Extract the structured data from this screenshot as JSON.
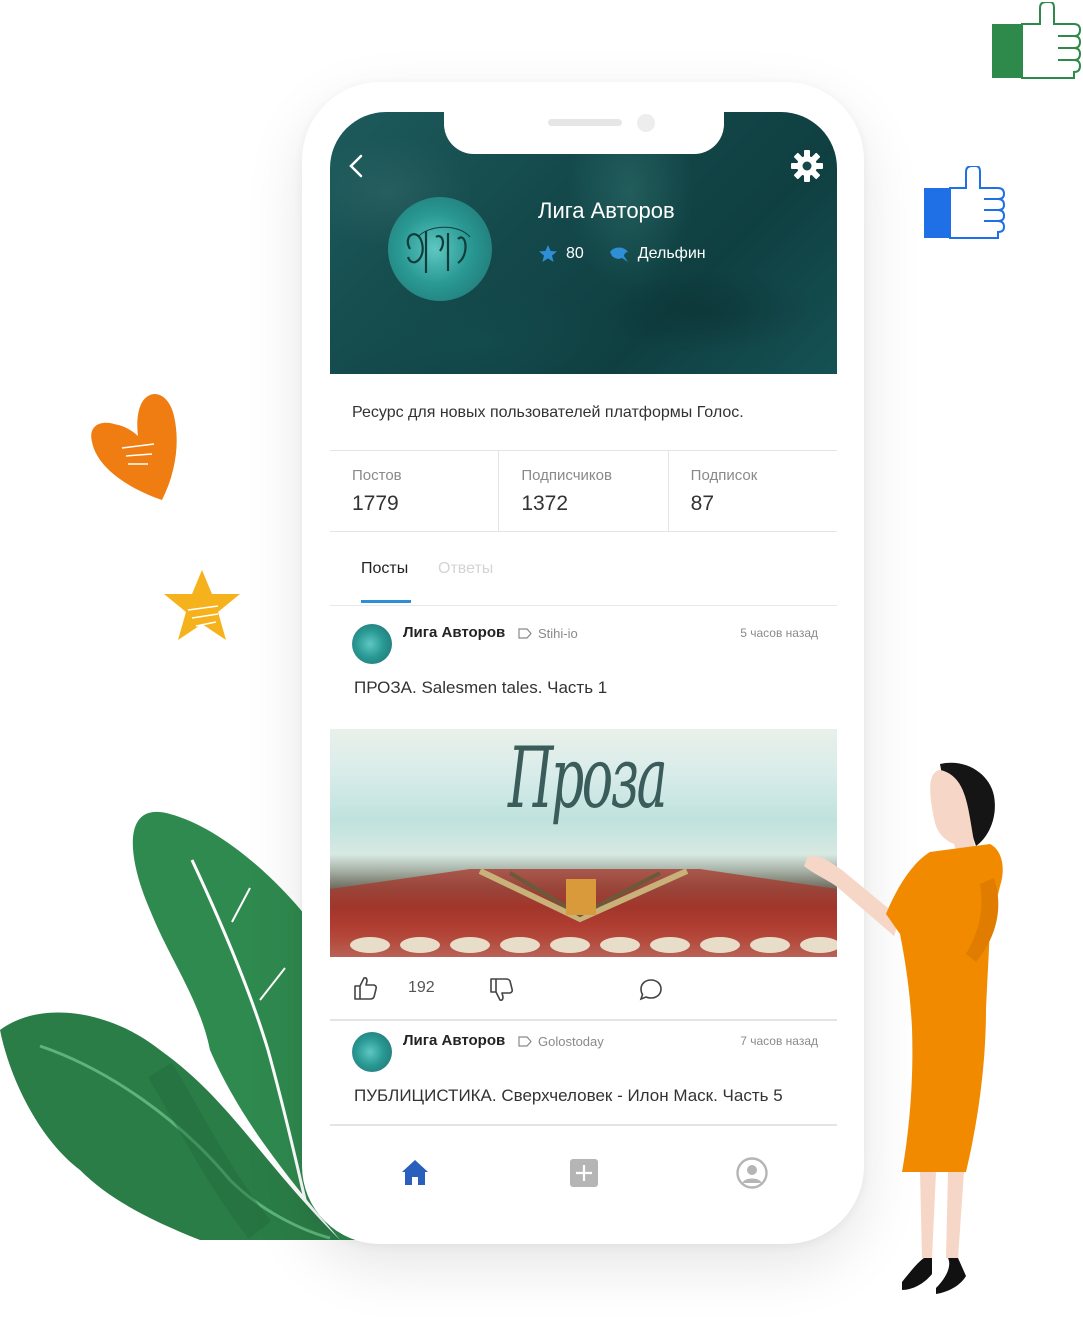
{
  "profile": {
    "name": "Лига Авторов",
    "rating": "80",
    "rank": "Дельфин",
    "description": "Ресурс для новых пользователей платформы Голос."
  },
  "stats": [
    {
      "label": "Постов",
      "value": "1779"
    },
    {
      "label": "Подписчиков",
      "value": "1372"
    },
    {
      "label": "Подписок",
      "value": "87"
    }
  ],
  "tabs": [
    {
      "label": "Посты",
      "active": true
    },
    {
      "label": "Ответы",
      "active": false
    }
  ],
  "posts": [
    {
      "author": "Лига Авторов",
      "tag": "Stihi-io",
      "time": "5 часов назад",
      "title": "ПРОЗА. Salesmen tales. Часть 1",
      "image_text": "Проза",
      "likes": "192"
    },
    {
      "author": "Лига Авторов",
      "tag": "Golostoday",
      "time": "7 часов назад",
      "title": "ПУБЛИЦИСТИКА. Сверхчеловек - Илон Маск. Часть 5"
    }
  ],
  "colors": {
    "banner": "#14494b",
    "accent": "#2e8fd6",
    "home_icon": "#2b5fbd",
    "orange": "#f28a00",
    "leaf_green": "#2f8a4f",
    "thumb_blue": "#1f6fe6",
    "thumb_green": "#2e8a4a"
  },
  "icons": {
    "back": "chevron-left-icon",
    "settings": "gear-icon",
    "rating": "star-icon",
    "rank": "dolphin-icon",
    "tag": "tag-icon",
    "like": "thumbs-up-icon",
    "dislike": "thumbs-down-icon",
    "comment": "comment-icon",
    "home": "home-icon",
    "create": "plus-square-icon",
    "profile": "user-circle-icon"
  }
}
